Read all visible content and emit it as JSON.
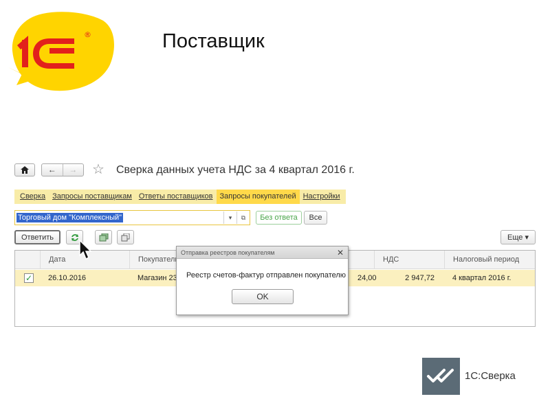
{
  "logo": {
    "text": "1С",
    "registered": "®",
    "colors": {
      "yellow": "#ffd400",
      "red": "#e2201c"
    }
  },
  "slide": {
    "title": "Поставщик"
  },
  "nav": {
    "home_icon": "home-icon",
    "back": "←",
    "forward": "→",
    "star_icon": "star-icon"
  },
  "form": {
    "title": "Сверка данных учета НДС за 4 квартал 2016 г."
  },
  "tabs": [
    {
      "label": "Сверка",
      "active": false
    },
    {
      "label": "Запросы поставщикам",
      "active": false
    },
    {
      "label": "Ответы поставщиков",
      "active": false
    },
    {
      "label": "Запросы покупателей",
      "active": true
    },
    {
      "label": "Настройки",
      "active": false
    }
  ],
  "filter": {
    "counterparty": "Торговый дом \"Комплексный\"",
    "no_reply": "Без ответа",
    "all": "Все"
  },
  "toolbar": {
    "reply": "Ответить",
    "more": "Еще ▾"
  },
  "table": {
    "columns": [
      "Дата",
      "Покупатель",
      "",
      "НДС",
      "Налоговый период"
    ],
    "rows": [
      {
        "checked": true,
        "date": "26.10.2016",
        "buyer": "Магазин 23",
        "sum": "24,00",
        "vat": "2 947,72",
        "period": "4 квартал 2016 г."
      }
    ]
  },
  "dialog": {
    "title": "Отправка реестров покупателям",
    "message": "Реестр счетов-фактур отправлен покупателю",
    "ok": "OK"
  },
  "brand": {
    "name": "1С:Сверка",
    "box_color": "#5b6b76"
  }
}
